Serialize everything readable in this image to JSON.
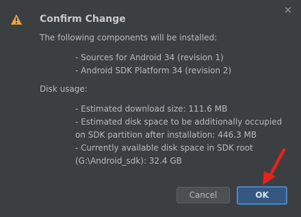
{
  "dialog": {
    "title": "Confirm Change",
    "intro": "The following components will be installed:",
    "components": [
      "- Sources for Android 34 (revision 1)",
      "- Android SDK Platform 34 (revision 2)"
    ],
    "disk_heading": "Disk usage:",
    "disk_lines": [
      "- Estimated download size: 111.6 MB",
      "- Estimated disk space to be additionally occupied",
      "on SDK partition after installation: 446.3 MB",
      "- Currently available disk space in SDK root",
      "(G:\\Android_sdk): 32.4 GB"
    ],
    "cancel_label": "Cancel",
    "ok_label": "OK",
    "close_glyph": "✕"
  },
  "icons": {
    "warning": "warning-icon",
    "close": "close-icon",
    "annotation": "red-arrow-annotation"
  },
  "colors": {
    "background": "#3c3f41",
    "text": "#bbbbbb",
    "warning": "#f0a732",
    "ok_button": "#365880",
    "ok_border": "#4a88c7",
    "annotation": "#e8211c"
  }
}
